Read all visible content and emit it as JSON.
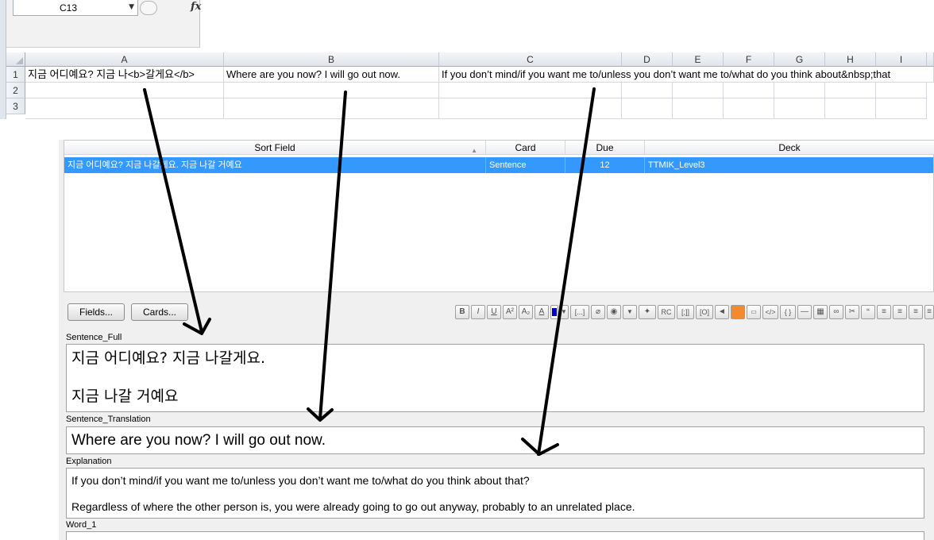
{
  "excel": {
    "namebox": "C13",
    "fx_label": "fx",
    "columns": [
      "A",
      "B",
      "C",
      "D",
      "E",
      "F",
      "G",
      "H",
      "I"
    ],
    "rows": [
      "1",
      "2",
      "3"
    ],
    "cells": {
      "A1": "지금 어디예요? 지금 나<b>갈게요</b>",
      "B1": "Where are you now? I will go out now.",
      "C1": "If you don’t mind/if you want me to/unless you don’t want me to/what do you think about&nbsp;that"
    }
  },
  "browser": {
    "headers": {
      "sort_field": "Sort Field",
      "card": "Card",
      "due": "Due",
      "deck": "Deck"
    },
    "row": {
      "sort_field": "지금 어디예요? 지금 나갈게요.    지금 나갈 거예요",
      "card": "Sentence",
      "due": "12",
      "deck": "TTMIK_Level3"
    },
    "fields_button": "Fields...",
    "cards_button": "Cards..."
  },
  "toolbar": [
    "B",
    "I",
    "U",
    "A²",
    "A₂",
    "",
    "",
    "▼",
    "[...]",
    "",
    "",
    "▼",
    "",
    "RC",
    "[;]]",
    "[O]",
    "",
    "",
    "",
    "</>",
    "{ }",
    "",
    "",
    "",
    "",
    "“",
    "",
    "",
    ""
  ],
  "editor": {
    "fields": [
      {
        "label": "Sentence_Full",
        "lines": [
          "지금 어디예요? 지금 나갈게요.",
          "지금 나갈 거예요"
        ]
      },
      {
        "label": "Sentence_Translation",
        "lines": [
          "Where are you now? I will go out now."
        ]
      },
      {
        "label": "Explanation",
        "lines": [
          "If you don’t mind/if you want me to/unless you don’t want me to/what do you think about that?",
          "Regardless of where the other person is, you were already going to go out anyway, probably to an unrelated place."
        ]
      },
      {
        "label": "Word_1",
        "lines": [
          ""
        ]
      }
    ]
  }
}
